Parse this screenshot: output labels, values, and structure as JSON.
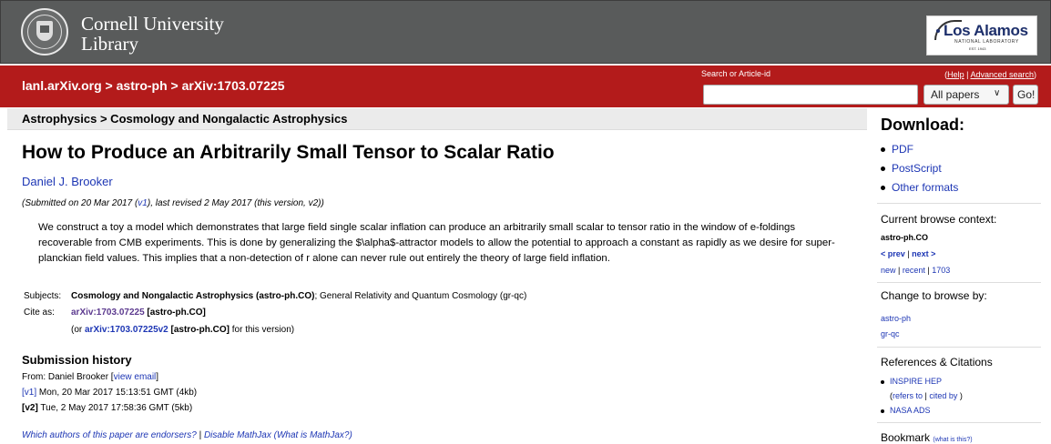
{
  "header": {
    "university_line1": "Cornell University",
    "university_line2": "Library",
    "logo_name": "Los Alamos",
    "logo_sub": "NATIONAL LABORATORY",
    "logo_est": "EST. 1943"
  },
  "redbar": {
    "crumb1": "lanl.arXiv.org",
    "crumb2": "astro-ph",
    "crumb3": "arXiv:1703.07225",
    "sep": " > ",
    "search_label": "Search or Article-id",
    "help_link": "Help",
    "advanced_link": "Advanced search",
    "search_placeholder": "",
    "select_value": "All papers",
    "go_label": "Go!"
  },
  "subject_header": "Astrophysics > Cosmology and Nongalactic Astrophysics",
  "paper": {
    "title": "How to Produce an Arbitrarily Small Tensor to Scalar Ratio",
    "author": "Daniel J. Brooker",
    "date_pre": "(Submitted on 20 Mar 2017 (",
    "date_v1": "v1",
    "date_post": "), last revised 2 May 2017 (this version, v2))",
    "abstract": "We construct a toy a model which demonstrates that large field single scalar inflation can produce an arbitrarily small scalar to tensor ratio in the window of e-foldings recoverable from CMB experiments. This is done by generalizing the $\\alpha$-attractor models to allow the potential to approach a constant as rapidly as we desire for super-planckian field values. This implies that a non-detection of r alone can never rule out entirely the theory of large field inflation.",
    "subjects_label": "Subjects:",
    "subjects_primary": "Cosmology and Nongalactic Astrophysics (astro-ph.CO)",
    "subjects_rest": "; General Relativity and Quantum Cosmology (gr-qc)",
    "cite_label": "Cite as:",
    "cite_id": "arXiv:1703.07225",
    "cite_tag": " [astro-ph.CO]",
    "cite2_pre": "(or ",
    "cite2_id": "arXiv:1703.07225v2",
    "cite2_tag": " [astro-ph.CO]",
    "cite2_post": " for this version)"
  },
  "history": {
    "title": "Submission history",
    "from_pre": "From: Daniel Brooker [",
    "from_link": "view email",
    "from_post": "]",
    "v1_label": "[v1]",
    "v1_date": " Mon, 20 Mar 2017 15:13:51 GMT (4kb)",
    "v2_label": "[v2]",
    "v2_date": " Tue, 2 May 2017 17:58:36 GMT (5kb)"
  },
  "footer": {
    "endorsers": "Which authors of this paper are endorsers?",
    "sep": " | ",
    "mathjax_disable": "Disable MathJax",
    "mathjax_what": " (What is MathJax?)"
  },
  "sidebar": {
    "download_title": "Download:",
    "downloads": [
      "PDF",
      "PostScript",
      "Other formats"
    ],
    "context_title": "Current browse context:",
    "context_value": "astro-ph.CO",
    "prev": "< prev",
    "next": "next >",
    "pipe": " | ",
    "new": "new",
    "recent": "recent",
    "month": "1703",
    "change_title": "Change to browse by:",
    "browse1": "astro-ph",
    "browse2": "gr-qc",
    "refs_title": "References & Citations",
    "inspire": "INSPIRE HEP",
    "refers_pre": "(",
    "refers_to": "refers to",
    "cited_by": "cited by",
    "refers_post": " )",
    "nasa": "NASA ADS",
    "bookmark_title": "Bookmark",
    "bookmark_what": "(what is this?)"
  },
  "colors": {
    "header_bg": "#595b5b",
    "red_bar": "#b31b1b",
    "link": "#1d36b4"
  }
}
